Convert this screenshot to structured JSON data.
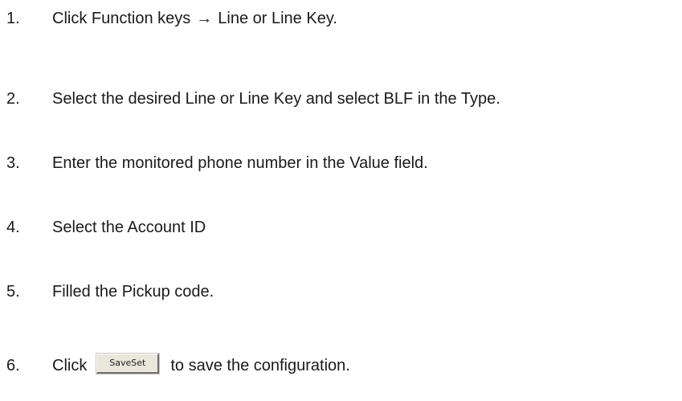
{
  "steps": [
    {
      "number": "1.",
      "text_before": "Click Function keys",
      "arrow": "→",
      "text_after": "Line or Line Key."
    },
    {
      "number": "2.",
      "text": "Select the desired Line or Line Key and select BLF in the Type."
    },
    {
      "number": "3.",
      "text": "Enter the monitored phone number in the Value field."
    },
    {
      "number": "4.",
      "text": "Select the Account ID"
    },
    {
      "number": "5.",
      "text": "Filled the Pickup code."
    },
    {
      "number": "6.",
      "text_before": "Click",
      "button_label": "SaveSet",
      "text_after": "to save the configuration."
    }
  ]
}
